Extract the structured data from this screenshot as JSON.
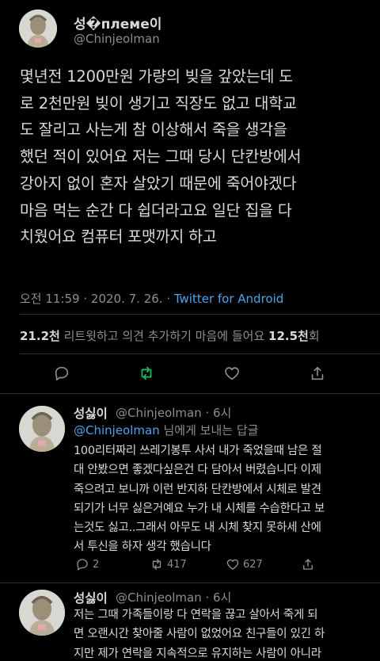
{
  "tweet": {
    "name": "성�племе이",
    "handle": "@Chinjeolman",
    "lines": [
      "몇년전 1200만원 가량의 빚을 갚았는데 도",
      "로 2천만원 빚이 생기고 직장도 없고 대학교",
      "도 잘리고 사는게 참 이상해서 죽을 생각을",
      "했던 적이 있어요 저는 그때 당시 단칸방에서",
      "강아지 없이 혼자 살았기 때문에 죽어야겠다",
      "마음 먹는 순간 다 쉽더라고요 일단 집을 다",
      "치웠어요 컴퓨터 포맷까지 하고"
    ],
    "time": "오전 11:59 · 2020. 7. 26. · ",
    "source": "Twitter for Android",
    "retweets": "21.2천",
    "retweets_label": " 리트윗하고 의견 추가하기  마음에 들어요 ",
    "likes": "12.5천",
    "likes_suffix": "회"
  },
  "replies": [
    {
      "name": "성싫이",
      "meta": "@Chinjeolman · 6시",
      "reply_to": "@Chinjeolman",
      "reply_suffix": " 님에게 보내는 답글",
      "lines": [
        "100리터짜리 쓰레기봉투 사서 내가 죽었을때 남은 절",
        "대 안봤으면 좋겠다싶은건 다 담아서 버렸습니다 이제",
        "죽으려고 보니까 이런 반지하 단칸방에서 시체로 발견",
        "되기가 너무 싫은거예요 누가 내 시체를 수습한다고 보",
        "는것도 싫고..그래서 아무도 내 시체 찾지 못하세 산에",
        "서 투신을 하자 생각 했습니다"
      ],
      "replies_count": "2",
      "retweets_count": "417",
      "likes_count": "627"
    },
    {
      "name": "성싫이",
      "meta": "@Chinjeolman · 6시",
      "lines": [
        "저는 그때 가족들이랑 다 연락을 끊고 살아서 죽게 되",
        "면 오랜시간 찾아줄 사람이 없었어요 친구들이 있긴 하",
        "지만 제가 연락을 지속적으로 유지하는 사람이 아니라"
      ]
    }
  ],
  "icons": {
    "reply": "reply-icon",
    "retweet": "retweet-icon",
    "like": "heart-icon",
    "share": "share-icon"
  },
  "colors": {
    "background": "#000000",
    "text": "#d9d9d9",
    "secondary": "#8a8f94",
    "link": "#4ea3e8",
    "retweet_green": "#17bf63"
  }
}
